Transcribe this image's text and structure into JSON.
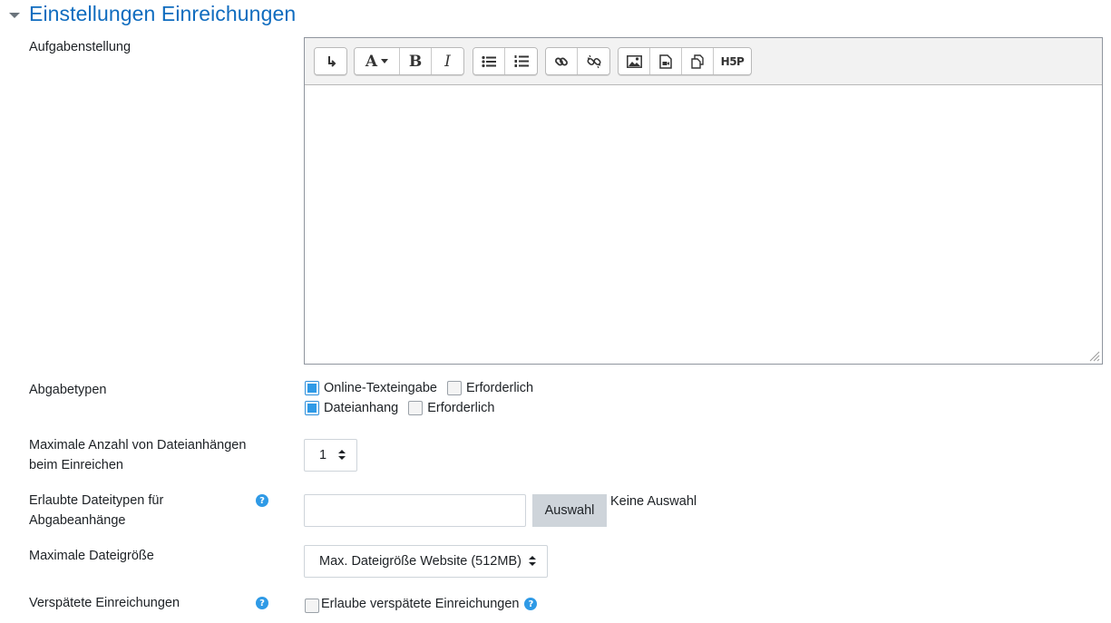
{
  "section": {
    "title": "Einstellungen Einreichungen",
    "chevron_icon": "chevron-down-icon"
  },
  "labels": {
    "instructions": "Aufgabenstellung",
    "submission_types": "Abgabetypen",
    "max_files_line1": "Maximale Anzahl von Dateianhängen",
    "max_files_line2": "beim Einreichen",
    "file_types_line1": "Erlaubte Dateitypen für",
    "file_types_line2": "Abgabeanhänge",
    "max_size": "Maximale Dateigröße",
    "late": "Verspätete Einreichungen"
  },
  "toolbar": {
    "groups": [
      [
        "toggle-toolbar-icon"
      ],
      [
        "font-color-icon",
        "bold-icon",
        "italic-icon"
      ],
      [
        "unordered-list-icon",
        "ordered-list-icon"
      ],
      [
        "link-icon",
        "unlink-icon"
      ],
      [
        "image-icon",
        "media-icon",
        "manage-files-icon",
        "h5p-icon"
      ]
    ],
    "bold_glyph": "B",
    "italic_glyph": "I",
    "font_glyph": "A",
    "h5p_glyph": "H5P"
  },
  "submission_types": [
    {
      "label": "Online-Texteingabe",
      "checked": true,
      "required_label": "Erforderlich",
      "required": false
    },
    {
      "label": "Dateianhang",
      "checked": true,
      "required_label": "Erforderlich",
      "required": false
    }
  ],
  "max_files": {
    "value": "1"
  },
  "file_types": {
    "value": "",
    "button_label": "Auswahl",
    "status": "Keine Auswahl"
  },
  "max_size": {
    "value": "Max. Dateigröße Website (512MB)"
  },
  "late": {
    "checkbox_label": "Erlaube verspätete Einreichungen",
    "checked": false
  },
  "colors": {
    "accent": "#0f6cbf",
    "help": "#2f9ae6",
    "checkbox": "#2f9ae6"
  }
}
